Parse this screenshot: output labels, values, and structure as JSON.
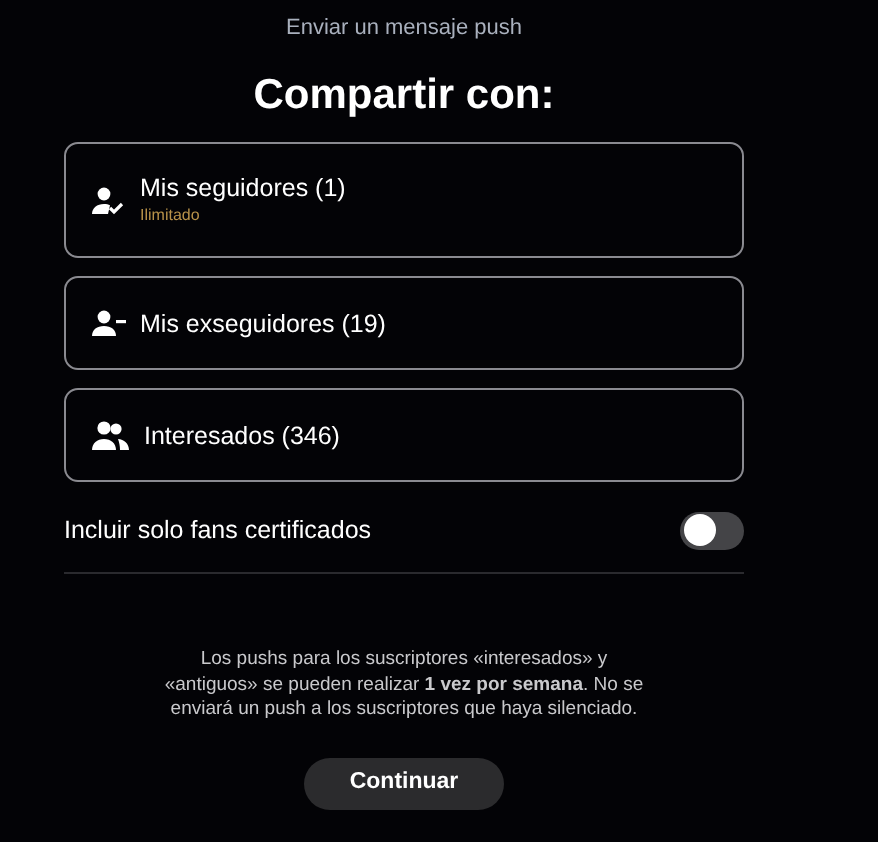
{
  "header": {
    "subtitle": "Enviar un mensaje push",
    "title": "Compartir con:"
  },
  "options": [
    {
      "kind": "user-check",
      "label": "Mis seguidores (1)",
      "note": "Ilimitado"
    },
    {
      "kind": "user-minus",
      "label": "Mis exseguidores (19)"
    },
    {
      "kind": "users",
      "label": "Interesados (346)"
    }
  ],
  "toggle": {
    "label": "Incluir solo fans certificados",
    "on": false
  },
  "info": "Los pushs para los suscriptores «interesados» y «antiguos» se pueden realizar **1 vez por semana**. No se enviará un push a los suscriptores que haya silenciado.",
  "button": "Continuar"
}
